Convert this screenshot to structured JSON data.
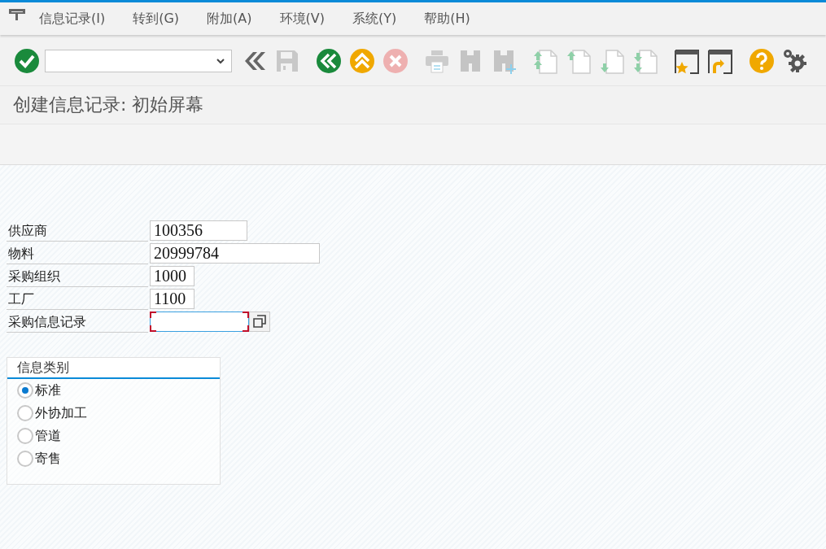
{
  "menu_bar": [
    {
      "label": "信息记录(I)"
    },
    {
      "label": "转到(G)"
    },
    {
      "label": "附加(A)"
    },
    {
      "label": "环境(V)"
    },
    {
      "label": "系统(Y)"
    },
    {
      "label": "帮助(H)"
    }
  ],
  "toolbar": {
    "buttons": [
      {
        "kind": "enter",
        "disabled": false
      },
      {
        "kind": "collapse",
        "disabled": false
      },
      {
        "kind": "save",
        "disabled": true
      },
      {
        "kind": "back",
        "disabled": false
      },
      {
        "kind": "exit",
        "disabled": false
      },
      {
        "kind": "cancel",
        "disabled": true
      },
      {
        "kind": "print",
        "disabled": true
      },
      {
        "kind": "find",
        "disabled": true
      },
      {
        "kind": "find-next",
        "disabled": true
      },
      {
        "kind": "first-page",
        "disabled": true
      },
      {
        "kind": "previous-page",
        "disabled": true
      },
      {
        "kind": "next-page",
        "disabled": true
      },
      {
        "kind": "last-page",
        "disabled": true
      },
      {
        "kind": "new-session"
      },
      {
        "kind": "shortcut"
      },
      {
        "kind": "help",
        "disabled": false
      },
      {
        "kind": "settings",
        "disabled": false
      }
    ]
  },
  "title": "创建信息记录: 初始屏幕",
  "fields": [
    {
      "label": "供应商",
      "value": "100356",
      "kind": "medium",
      "focused": false
    },
    {
      "label": "物料",
      "value": "20999784",
      "kind": "long",
      "focused": false
    },
    {
      "label": "采购组织",
      "value": "1000",
      "kind": "short",
      "focused": false
    },
    {
      "label": "工厂",
      "value": "1100",
      "kind": "short",
      "focused": false
    },
    {
      "label": "采购信息记录",
      "kind": "search",
      "focused": true
    }
  ],
  "info_category": {
    "title": "信息类别",
    "options": [
      {
        "label": "标准",
        "selected": true
      },
      {
        "label": "外协加工",
        "selected": false
      },
      {
        "label": "管道",
        "selected": false
      },
      {
        "label": "寄售",
        "selected": false
      }
    ]
  }
}
